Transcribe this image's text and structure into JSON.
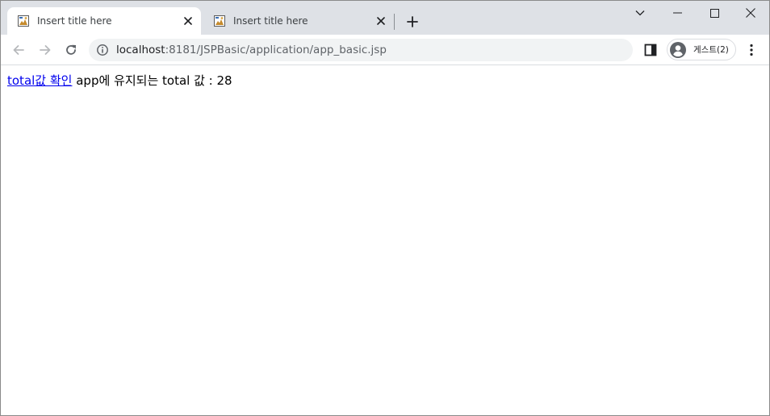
{
  "browser": {
    "tabs": [
      {
        "title": "Insert title here",
        "active": true
      },
      {
        "title": "Insert title here",
        "active": false
      }
    ],
    "address": {
      "host": "localhost",
      "path": ":8181/JSPBasic/application/app_basic.jsp"
    },
    "profile_label": "게스트(2)"
  },
  "page": {
    "link_text": "total값 확인",
    "message": " app에 유지되는 total 값 : 28"
  },
  "icons": {
    "favicon": "image-file-icon",
    "tab_close": "close-icon",
    "new_tab": "plus-icon",
    "tab_search": "chevron-down-icon",
    "minimize": "minimize-icon",
    "maximize": "maximize-icon",
    "close_window": "close-icon",
    "back": "arrow-left-icon",
    "forward": "arrow-right-icon",
    "reload": "reload-icon",
    "site_info": "info-icon",
    "side_panel": "side-panel-icon",
    "profile": "person-icon",
    "menu": "kebab-menu-icon"
  },
  "colors": {
    "tabstrip": "#dee1e6",
    "omnibox": "#f1f3f4",
    "link": "#0000ee"
  }
}
